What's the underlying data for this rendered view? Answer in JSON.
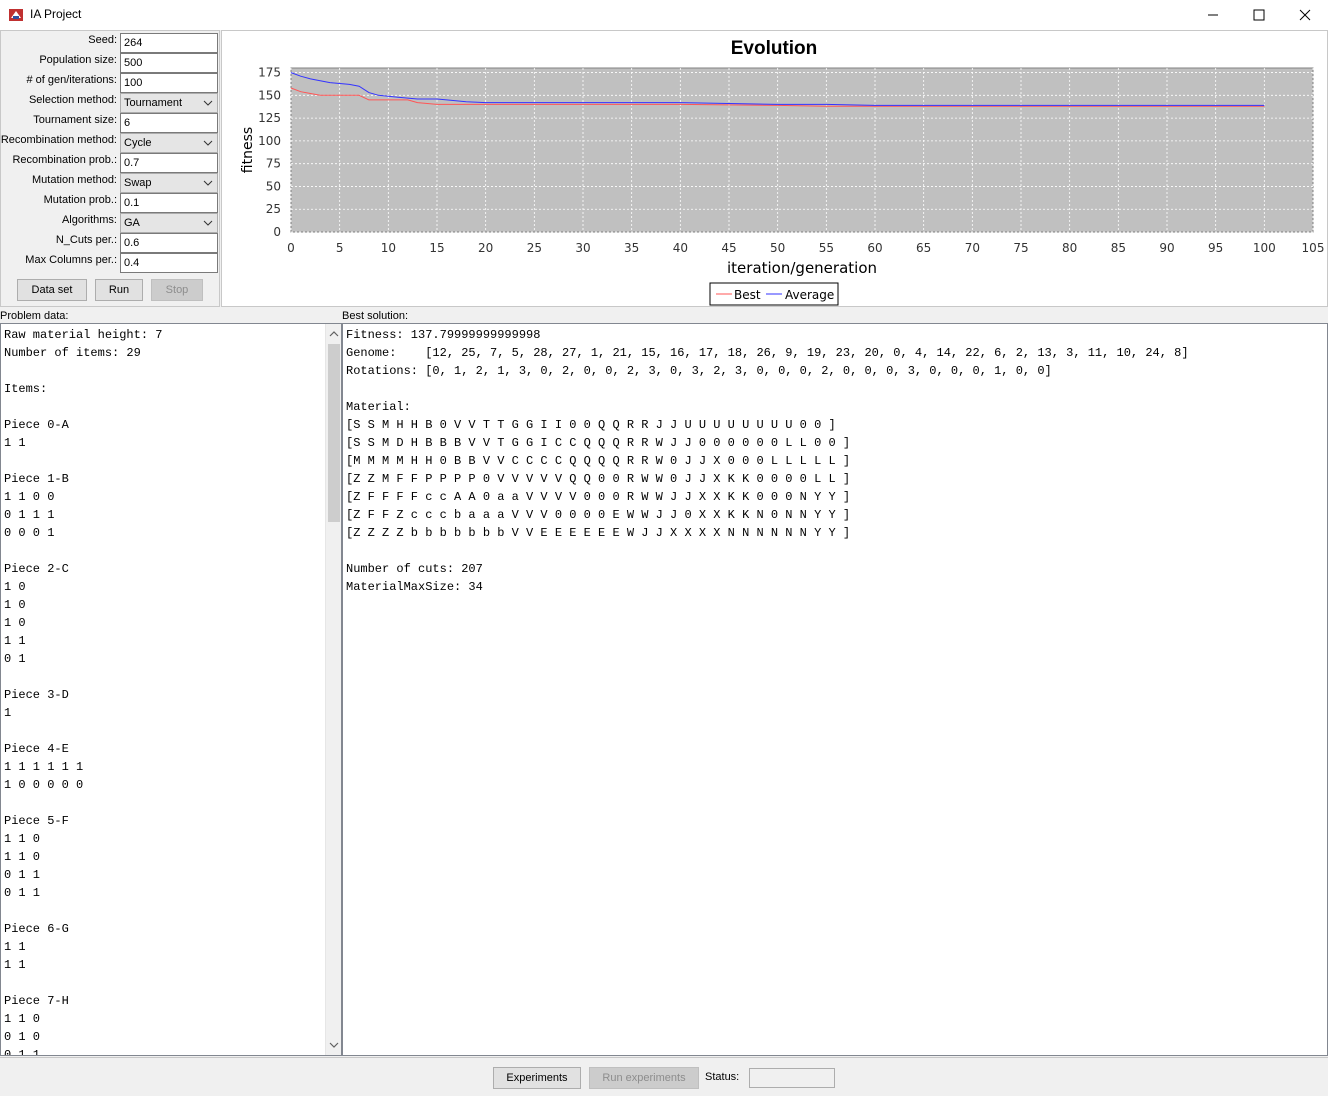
{
  "window": {
    "title": "IA Project"
  },
  "params": [
    {
      "label": "Seed:",
      "value": "264",
      "kind": "input"
    },
    {
      "label": "Population size:",
      "value": "500",
      "kind": "input"
    },
    {
      "label": "# of gen/iterations:",
      "value": "100",
      "kind": "input"
    },
    {
      "label": "Selection method:",
      "value": "Tournament",
      "kind": "select"
    },
    {
      "label": "Tournament size:",
      "value": "6",
      "kind": "input"
    },
    {
      "label": "Recombination method:",
      "value": "Cycle",
      "kind": "select"
    },
    {
      "label": "Recombination prob.:",
      "value": "0.7",
      "kind": "input"
    },
    {
      "label": "Mutation method:",
      "value": "Swap",
      "kind": "select"
    },
    {
      "label": "Mutation prob.:",
      "value": "0.1",
      "kind": "input"
    },
    {
      "label": "Algorithms:",
      "value": "GA",
      "kind": "select"
    },
    {
      "label": "N_Cuts per.:",
      "value": "0.6",
      "kind": "input"
    },
    {
      "label": "Max Columns per.:",
      "value": "0.4",
      "kind": "input"
    }
  ],
  "buttons": {
    "dataset": "Data set",
    "run": "Run",
    "stop": "Stop"
  },
  "chart_data": {
    "type": "line",
    "title": "Evolution",
    "xlabel": "iteration/generation",
    "ylabel": "fitness",
    "xlim": [
      0,
      105
    ],
    "ylim": [
      0,
      180
    ],
    "xticks": [
      "0",
      "5",
      "10",
      "15",
      "20",
      "25",
      "30",
      "35",
      "40",
      "45",
      "50",
      "55",
      "60",
      "65",
      "70",
      "75",
      "80",
      "85",
      "90",
      "95",
      "100",
      "105"
    ],
    "yticks": [
      "0",
      "25",
      "50",
      "75",
      "100",
      "125",
      "150",
      "175"
    ],
    "grid": true,
    "legend_position": "bottom",
    "series": [
      {
        "name": "Best",
        "color": "#ff5555",
        "x": [
          0,
          1,
          2,
          3,
          4,
          5,
          6,
          7,
          8,
          9,
          10,
          11,
          12,
          13,
          14,
          15,
          20,
          30,
          40,
          50,
          55,
          60,
          70,
          80,
          90,
          100
        ],
        "y": [
          158,
          154,
          152,
          150,
          150,
          150,
          150,
          150,
          145,
          145,
          145,
          145,
          145,
          142,
          141,
          140,
          140,
          140,
          140,
          139,
          138,
          138,
          138,
          138,
          138,
          138
        ]
      },
      {
        "name": "Average",
        "color": "#3333ff",
        "x": [
          0,
          1,
          2,
          3,
          4,
          5,
          6,
          7,
          8,
          9,
          10,
          11,
          12,
          13,
          14,
          15,
          16,
          18,
          20,
          25,
          30,
          40,
          45,
          50,
          55,
          60,
          65,
          70,
          75,
          80,
          85,
          90,
          95,
          100
        ],
        "y": [
          175,
          171,
          168,
          166,
          164,
          163,
          162,
          160,
          153,
          150,
          149,
          148,
          147,
          146,
          146,
          146,
          145,
          143,
          142,
          142,
          142,
          142,
          141,
          140,
          140,
          139,
          139,
          139,
          139,
          139,
          139,
          139,
          139,
          139
        ]
      }
    ]
  },
  "problem": {
    "label": "Problem data:",
    "lines": [
      "Raw material height: 7",
      "Number of items: 29",
      "",
      "Items:",
      "",
      "Piece 0-A",
      "1 1",
      "",
      "Piece 1-B",
      "1 1 0 0",
      "0 1 1 1",
      "0 0 0 1",
      "",
      "Piece 2-C",
      "1 0",
      "1 0",
      "1 0",
      "1 1",
      "0 1",
      "",
      "Piece 3-D",
      "1",
      "",
      "Piece 4-E",
      "1 1 1 1 1 1",
      "1 0 0 0 0 0",
      "",
      "Piece 5-F",
      "1 1 0",
      "1 1 0",
      "0 1 1",
      "0 1 1",
      "",
      "Piece 6-G",
      "1 1",
      "1 1",
      "",
      "Piece 7-H",
      "1 1 0",
      "0 1 0",
      "0 1 1"
    ]
  },
  "solution": {
    "label": "Best solution:",
    "lines": [
      "Fitness: 137.79999999999998",
      "Genome:    [12, 25, 7, 5, 28, 27, 1, 21, 15, 16, 17, 18, 26, 9, 19, 23, 20, 0, 4, 14, 22, 6, 2, 13, 3, 11, 10, 24, 8]",
      "Rotations: [0, 1, 2, 1, 3, 0, 2, 0, 0, 2, 3, 0, 3, 2, 3, 0, 0, 0, 2, 0, 0, 0, 3, 0, 0, 0, 1, 0, 0]",
      "",
      "Material:",
      "[S S M H H B 0 V V T T G G I I 0 0 Q Q R R J J U U U U U U U U 0 0 ]",
      "[S S M D H B B B V V T G G I C C Q Q Q R R W J J 0 0 0 0 0 0 L L 0 0 ]",
      "[M M M M H H 0 B B V V C C C C Q Q Q Q R R W 0 J J X 0 0 0 L L L L L ]",
      "[Z Z M F F P P P P 0 V V V V V Q Q 0 0 R W W 0 J J X K K 0 0 0 0 L L ]",
      "[Z F F F F c c A A 0 a a V V V V 0 0 0 R W W J J X X K K 0 0 0 N Y Y ]",
      "[Z F F Z c c c b a a a V V V 0 0 0 0 E W W J J 0 X X K K N 0 N N Y Y ]",
      "[Z Z Z Z b b b b b b b V V E E E E E E W J J X X X X N N N N N N Y Y ]",
      "",
      "Number of cuts: 207",
      "MaterialMaxSize: 34"
    ]
  },
  "footer": {
    "experiments": "Experiments",
    "run_experiments": "Run experiments",
    "status_label": "Status:",
    "status_value": ""
  }
}
